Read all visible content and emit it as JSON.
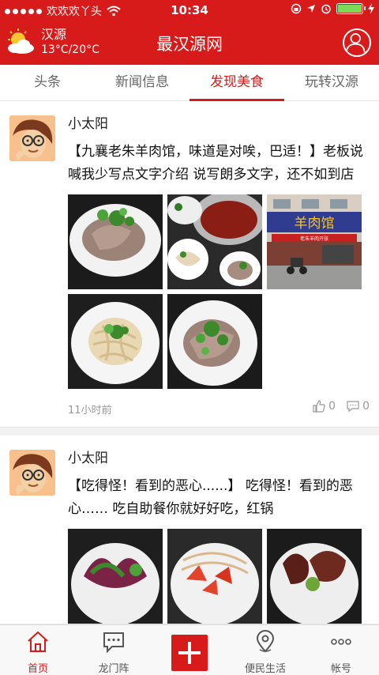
{
  "status_bar": {
    "carrier": "欢欢欢丫头",
    "time": "10:34"
  },
  "header": {
    "city": "汉源",
    "temperature": "13°C/20°C",
    "title": "最汉源网",
    "weather_icon": "partly-cloudy-icon",
    "user_icon": "user-icon"
  },
  "tabs": [
    {
      "label": "头条",
      "active": false
    },
    {
      "label": "新闻信息",
      "active": false
    },
    {
      "label": "发现美食",
      "active": true
    },
    {
      "label": "玩转汉源",
      "active": false
    }
  ],
  "posts": [
    {
      "author": "小太阳",
      "text": "【九襄老朱羊肉馆，味道是对唉，巴适！】老板说喊我少写点文字介绍  说写朗多文字，还不如到店",
      "time": "11小时前",
      "likes": "0",
      "comments": "0",
      "images": [
        "sliced-mutton-plate",
        "hot-pot",
        "restaurant-storefront",
        "noodles-plate",
        "mutton-plate"
      ],
      "storefront_sign": "羊肉馆",
      "storefront_banner": "老朱羊肉开张"
    },
    {
      "author": "小太阳",
      "text": "【吃得怪！看到的恶心......】    吃得怪！看到的恶心……        吃自助餐你就好好吃，红锅",
      "images": [
        "vegetable-dish",
        "tomato-dish",
        "meat-dish"
      ]
    }
  ],
  "bottom_nav": [
    {
      "label": "首页",
      "icon": "home-icon",
      "active": true
    },
    {
      "label": "龙门阵",
      "icon": "chat-bubble-icon",
      "active": false
    },
    {
      "label": "",
      "icon": "plus-icon",
      "active": false
    },
    {
      "label": "便民生活",
      "icon": "location-pin-icon",
      "active": false
    },
    {
      "label": "帐号",
      "icon": "more-dots-icon",
      "active": false
    }
  ],
  "colors": {
    "brand_red": "#d71b1b",
    "tab_inactive": "#666666",
    "meta_gray": "#999999"
  }
}
